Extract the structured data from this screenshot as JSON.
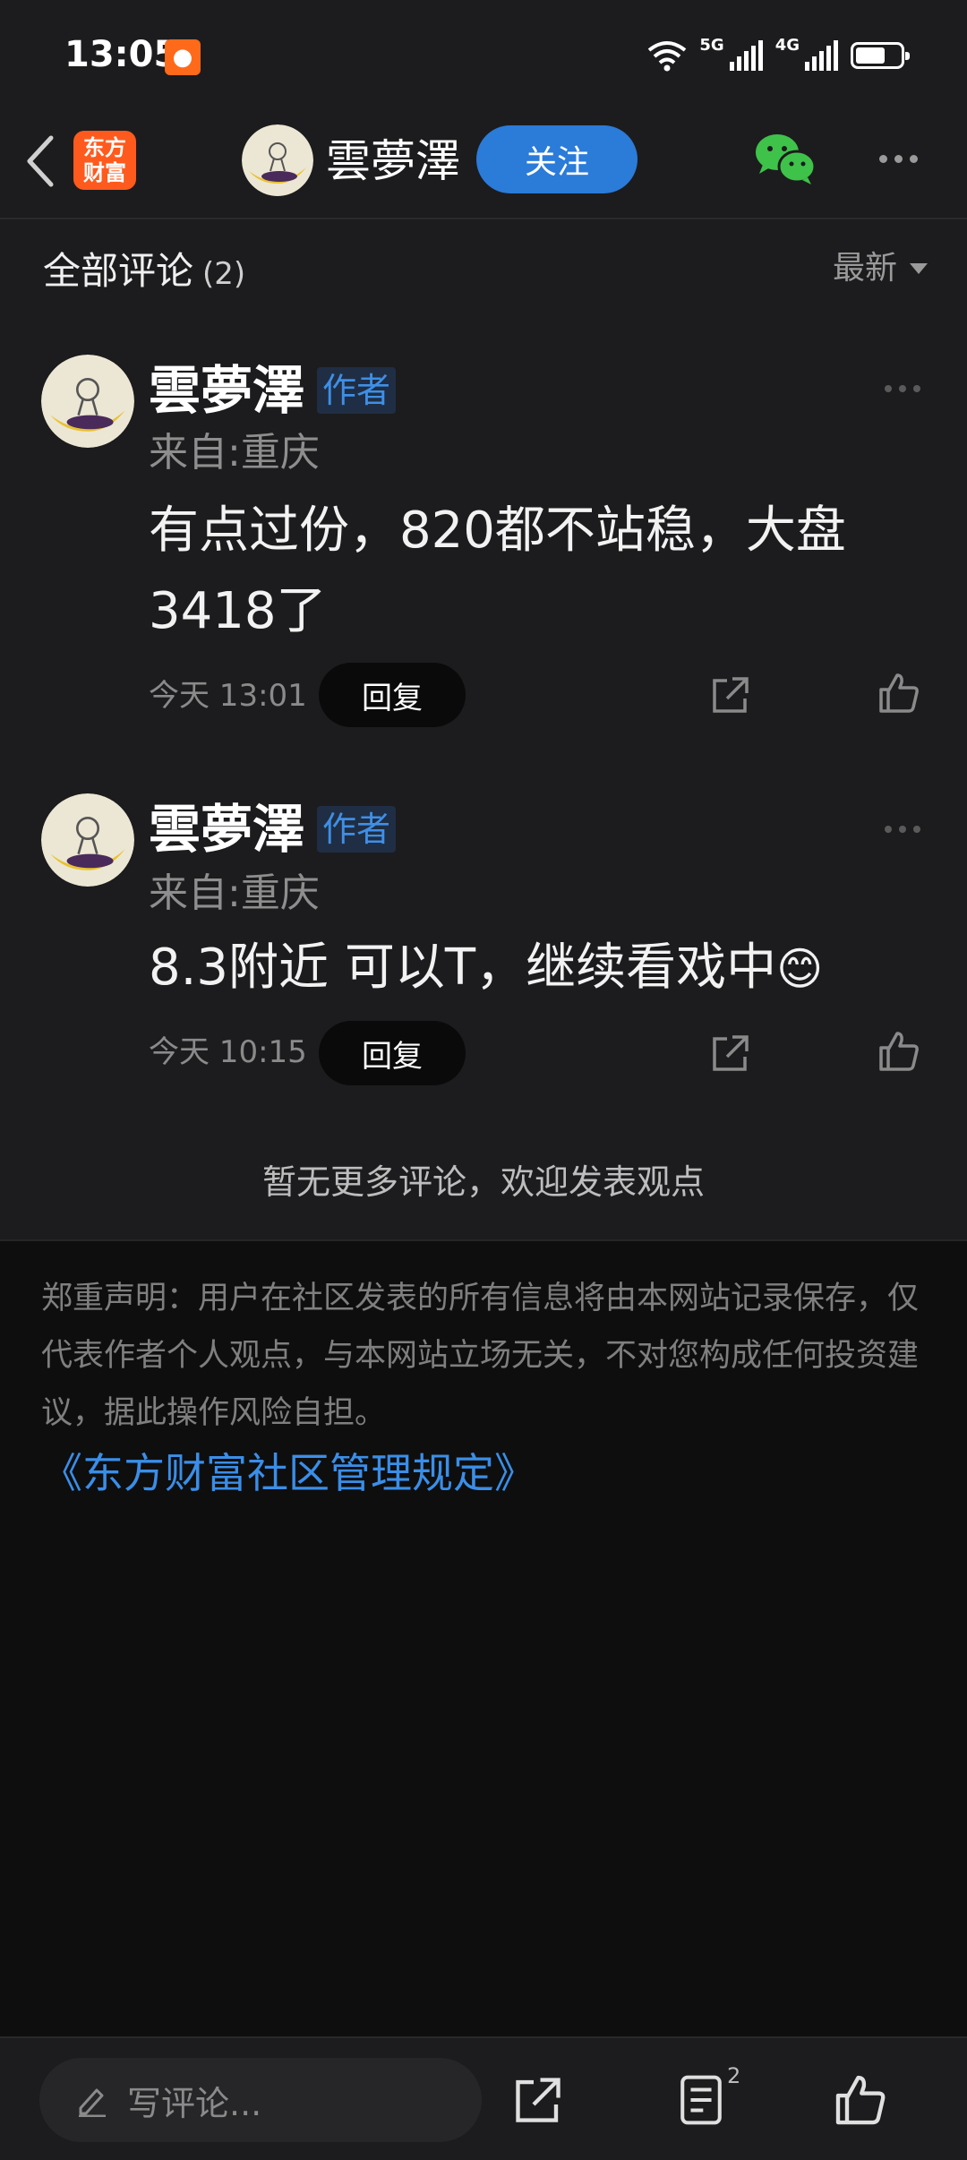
{
  "status_bar": {
    "time": "13:05",
    "notification_icon": "app-notification-icon",
    "net1": "5G",
    "net2": "4G"
  },
  "header": {
    "app_logo_line1": "东方",
    "app_logo_line2": "财富",
    "user_name": "雲夢澤",
    "follow_label": "关注"
  },
  "comments_header": {
    "title": "全部评论",
    "count": "(2)",
    "sort_label": "最新"
  },
  "comments": [
    {
      "name": "雲夢澤",
      "tag": "作者",
      "location": "来自:重庆",
      "text": "有点过份，820都不站稳，大盘3418了",
      "time": "今天 13:01",
      "reply_label": "回复"
    },
    {
      "name": "雲夢澤",
      "tag": "作者",
      "location": "来自:重庆",
      "text": "8.3附近 可以T，继续看戏中",
      "emoji": "😊",
      "time": "今天 10:15",
      "reply_label": "回复"
    }
  ],
  "no_more_text": "暂无更多评论，欢迎发表观点",
  "disclaimer": "郑重声明：用户在社区发表的所有信息将由本网站记录保存，仅代表作者个人观点，与本网站立场无关，不对您构成任何投资建议，据此操作风险自担。",
  "rules_link": "《东方财富社区管理规定》",
  "bottom_bar": {
    "comment_placeholder": "写评论...",
    "list_badge": "2"
  },
  "colors": {
    "accent_blue": "#2b7bd9",
    "link_blue": "#3a8ee8",
    "brand_orange": "#ff5a1e",
    "wechat_green": "#3fc24a"
  }
}
